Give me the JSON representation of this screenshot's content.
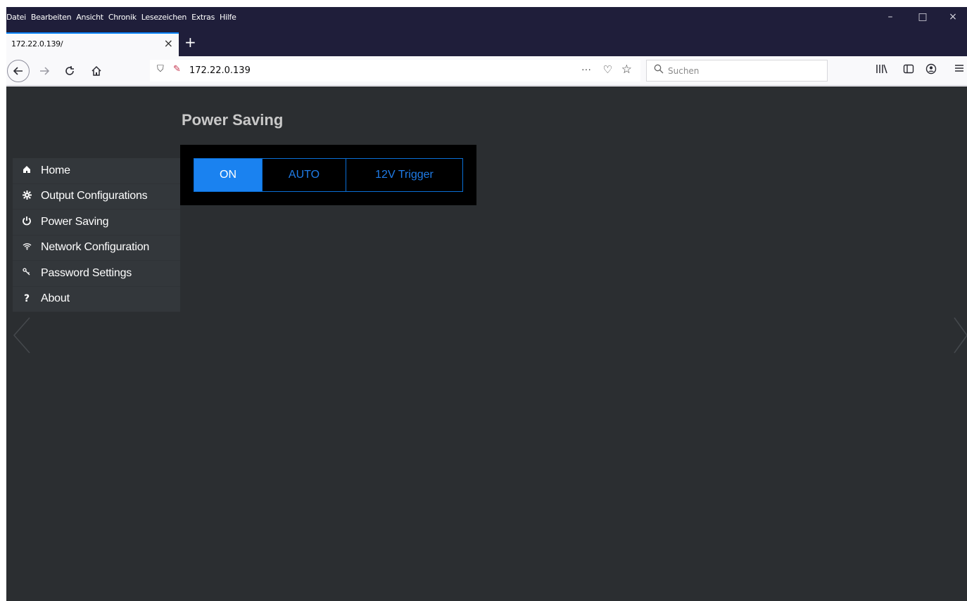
{
  "browser": {
    "menu": [
      {
        "label": "Datei"
      },
      {
        "label": "Bearbeiten"
      },
      {
        "label": "Ansicht"
      },
      {
        "label": "Chronik"
      },
      {
        "label": "Lesezeichen"
      },
      {
        "label": "Extras"
      },
      {
        "label": "Hilfe"
      }
    ],
    "window_controls": {
      "minimize": "–",
      "maximize": "□",
      "close": "×"
    },
    "tab": {
      "title": "172.22.0.139/",
      "close": "×"
    },
    "new_tab": "+",
    "url": "172.22.0.139",
    "search_placeholder": "Suchen",
    "page_actions": "···"
  },
  "page": {
    "title": "Power Saving",
    "sidebar": [
      {
        "label": "Home",
        "icon": "home-icon"
      },
      {
        "label": "Output Configurations",
        "icon": "gear-icon"
      },
      {
        "label": "Power Saving",
        "icon": "power-icon"
      },
      {
        "label": "Network Configuration",
        "icon": "wifi-icon"
      },
      {
        "label": "Password Settings",
        "icon": "key-icon"
      },
      {
        "label": "About",
        "icon": "question-icon"
      }
    ],
    "power_modes": [
      {
        "label": "ON",
        "active": true
      },
      {
        "label": "AUTO",
        "active": false
      },
      {
        "label": "12V Trigger",
        "active": false
      }
    ],
    "colors": {
      "background": "#2b2e31",
      "accent": "#1a82f0",
      "sidebar": "#33373b",
      "titlebar": "#1f1e3a"
    }
  }
}
